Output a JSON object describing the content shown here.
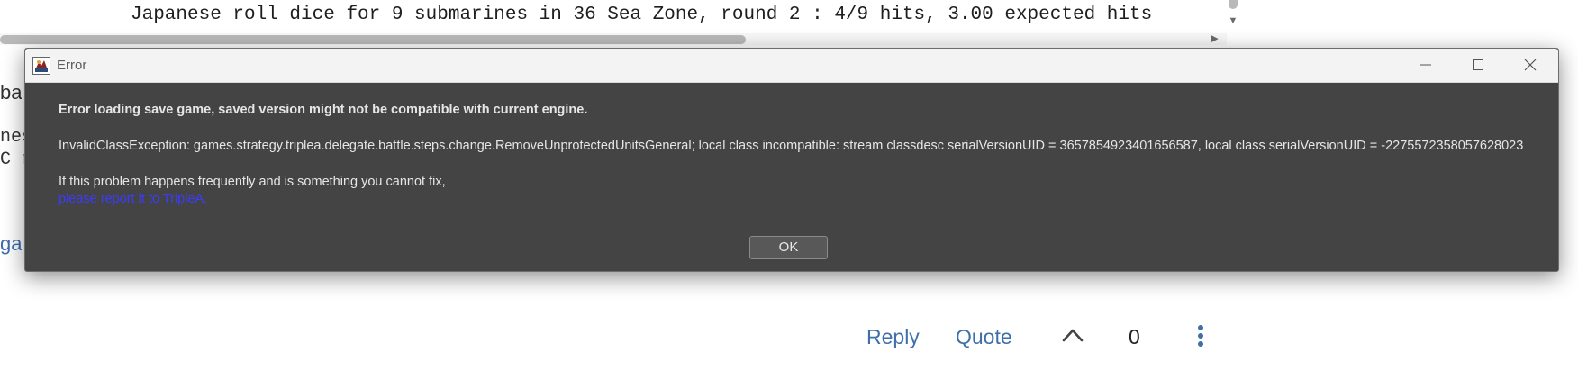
{
  "background": {
    "code_line": "Japanese roll dice for 9 submarines in 36 Sea Zone, round 2 : 4/9 hits, 3.00 expected hits",
    "fragments": [
      "ba",
      "nes",
      "C r",
      "ga"
    ]
  },
  "post_actions": {
    "reply_label": "Reply",
    "quote_label": "Quote",
    "vote_count": "0"
  },
  "dialog": {
    "title": "Error",
    "heading": "Error loading save game, saved version might not be compatible with current engine.",
    "detail": "InvalidClassException: games.strategy.triplea.delegate.battle.steps.change.RemoveUnprotectedUnitsGeneral; local class incompatible: stream classdesc serialVersionUID = 3657854923401656587, local class serialVersionUID = -2275572358057628023",
    "hint": "If this problem happens frequently and is something you cannot fix,",
    "report_link": "please report it to TripleA.",
    "ok_label": "OK"
  },
  "icons": {
    "app": "triplea-app-icon",
    "upvote": "chevron-up-icon",
    "more": "vertical-dots-icon"
  },
  "colors": {
    "dialog_bg": "#444444",
    "link": "#3b3bff",
    "forum_accent": "#3f6fab"
  }
}
